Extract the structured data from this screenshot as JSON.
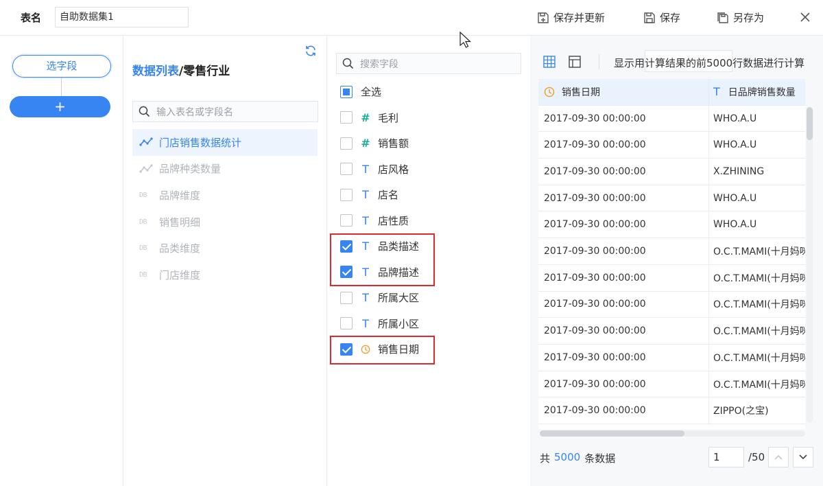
{
  "header": {
    "table_name_label": "表名",
    "table_name_value": "自助数据集1",
    "actions": [
      {
        "label": "保存并更新",
        "icon": "save-update-icon"
      },
      {
        "label": "保存",
        "icon": "save-icon"
      },
      {
        "label": "另存为",
        "icon": "save-as-icon"
      }
    ],
    "close_icon": "close-icon"
  },
  "steps": {
    "select_fields_label": "选字段",
    "add_label": "+"
  },
  "tables_panel": {
    "breadcrumb_root": "数据列表",
    "breadcrumb_sep": "/",
    "breadcrumb_current": "零售行业",
    "search_placeholder": "输入表名或字段名",
    "items": [
      {
        "label": "门店销售数据统计",
        "type": "analysis",
        "active": true
      },
      {
        "label": "品牌种类数量",
        "type": "analysis",
        "active": false
      },
      {
        "label": "品牌维度",
        "type": "db",
        "active": false
      },
      {
        "label": "销售明细",
        "type": "db",
        "active": false
      },
      {
        "label": "品类维度",
        "type": "db",
        "active": false
      },
      {
        "label": "门店维度",
        "type": "db",
        "active": false
      }
    ],
    "db_tag": "DB"
  },
  "fields_panel": {
    "search_placeholder": "搜索字段",
    "select_all_label": "全选",
    "fields": [
      {
        "label": "毛利",
        "type": "#",
        "checked": false
      },
      {
        "label": "销售额",
        "type": "#",
        "checked": false
      },
      {
        "label": "店风格",
        "type": "T",
        "checked": false
      },
      {
        "label": "店名",
        "type": "T",
        "checked": false
      },
      {
        "label": "店性质",
        "type": "T",
        "checked": false
      },
      {
        "label": "品类描述",
        "type": "T",
        "checked": true
      },
      {
        "label": "品牌描述",
        "type": "T",
        "checked": true
      },
      {
        "label": "所属大区",
        "type": "T",
        "checked": false
      },
      {
        "label": "所属小区",
        "type": "T",
        "checked": false
      },
      {
        "label": "销售日期",
        "type": "date",
        "checked": true
      }
    ]
  },
  "preview": {
    "toolbar_text": "显示用计算结果的前5000行数据进行计算",
    "columns": [
      {
        "label": "销售日期",
        "type_icon": "clock-icon"
      },
      {
        "label": "日品牌销售数量",
        "type_icon": "T"
      }
    ],
    "rows": [
      [
        "2017-09-30 00:00:00",
        "WHO.A.U"
      ],
      [
        "2017-09-30 00:00:00",
        "WHO.A.U"
      ],
      [
        "2017-09-30 00:00:00",
        "X.ZHINING"
      ],
      [
        "2017-09-30 00:00:00",
        "WHO.A.U"
      ],
      [
        "2017-09-30 00:00:00",
        "WHO.A.U"
      ],
      [
        "2017-09-30 00:00:00",
        "O.C.T.MAMI(十月妈咪)"
      ],
      [
        "2017-09-30 00:00:00",
        "O.C.T.MAMI(十月妈咪)"
      ],
      [
        "2017-09-30 00:00:00",
        "O.C.T.MAMI(十月妈咪)"
      ],
      [
        "2017-09-30 00:00:00",
        "O.C.T.MAMI(十月妈咪)"
      ],
      [
        "2017-09-30 00:00:00",
        "O.C.T.MAMI(十月妈咪)"
      ],
      [
        "2017-09-30 00:00:00",
        "O.C.T.MAMI(十月妈咪)"
      ],
      [
        "2017-09-30 00:00:00",
        "ZIPPO(之宝)"
      ]
    ],
    "footer_prefix": "共",
    "total_count": "5000",
    "footer_suffix": "条数据",
    "page_value": "1",
    "page_total": "/50"
  },
  "colors": {
    "accent": "#3685f2",
    "highlight_border": "#e0282e",
    "number_type": "#19b09b",
    "date_type": "#f0a030"
  }
}
